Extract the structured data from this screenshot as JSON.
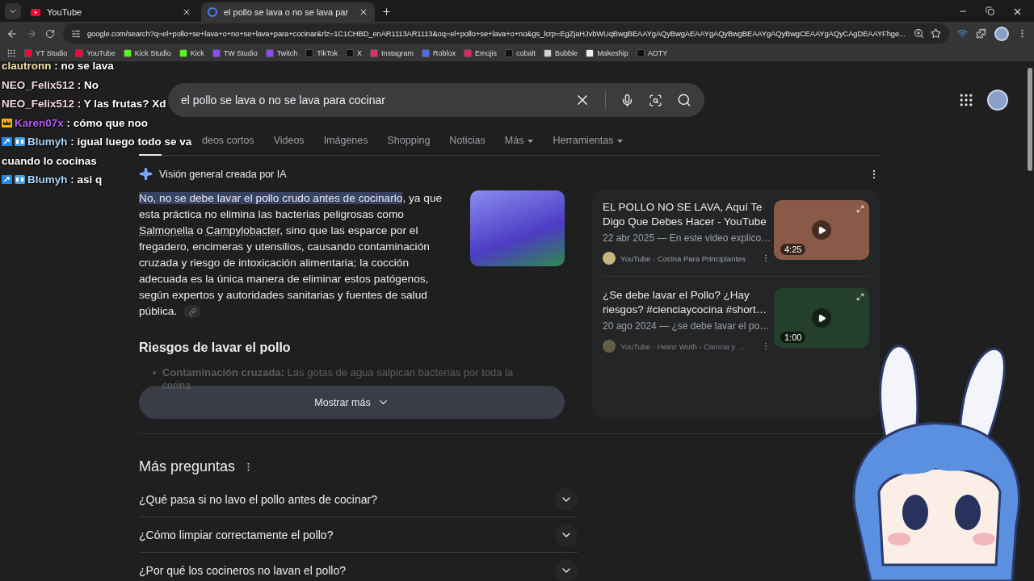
{
  "browser": {
    "tabs": [
      {
        "title": "YouTube",
        "selected": false
      },
      {
        "title": "el pollo se lava o no se lava par",
        "selected": true
      }
    ],
    "address": "google.com/search?q=el+pollo+se+lava+o+no+se+lava+para+cocinar&rlz=1C1CHBD_enAR1113AR1113&oq=el+pollo+se+lava+o+no&gs_lcrp=EgZjaHJvbWUqBwgBEAAYgAQyBwgAEAAYgAQyBwgBEAAYgAQyBwgCEAAYgAQyCAgDEAAYFhge...",
    "bookmarks": [
      {
        "label": "YT Studio",
        "color": "#ff0033"
      },
      {
        "label": "YouTube",
        "color": "#ff0033"
      },
      {
        "label": "Kick Studio",
        "color": "#53fc18"
      },
      {
        "label": "Kick",
        "color": "#53fc18"
      },
      {
        "label": "TW Studio",
        "color": "#9146ff"
      },
      {
        "label": "Twitch",
        "color": "#9146ff"
      },
      {
        "label": "TikTok",
        "color": "#111111"
      },
      {
        "label": "X",
        "color": "#111111"
      },
      {
        "label": "Instagram",
        "color": "#e1306c"
      },
      {
        "label": "Roblox",
        "color": "#4a6cf7"
      },
      {
        "label": "Emojis",
        "color": "#e0245e"
      },
      {
        "label": "cobalt",
        "color": "#111111"
      },
      {
        "label": "Bubble",
        "color": "#d0d0d0"
      },
      {
        "label": "Makeship",
        "color": "#f0f0f0"
      },
      {
        "label": "AOTY",
        "color": "#111111"
      }
    ]
  },
  "search": {
    "query": "el pollo se lava o no se lava para cocinar",
    "tabs": [
      {
        "label": "deos cortos"
      },
      {
        "label": "Videos"
      },
      {
        "label": "Imágenes"
      },
      {
        "label": "Shopping"
      },
      {
        "label": "Noticias"
      },
      {
        "label": "Más",
        "menu": true
      },
      {
        "label": "Herramientas",
        "menu": true
      }
    ]
  },
  "ai_overview": {
    "title": "Visión general creada por IA",
    "paragraph": [
      {
        "kind": "highlight",
        "text": "No, no se debe lavar el pollo crudo antes de cocinarlo"
      },
      {
        "kind": "plain",
        "text": ", ya que esta práctica no elimina las bacterias peligrosas como "
      },
      {
        "kind": "link",
        "text": "Salmonella"
      },
      {
        "kind": "plain",
        "text": " o "
      },
      {
        "kind": "link",
        "text": "Campylobacter"
      },
      {
        "kind": "plain",
        "text": ", sino que las esparce por el fregadero, encimeras y utensilios, causando contaminación cruzada y riesgo de intoxicación alimentaria; la cocción adecuada es la única manera de eliminar estos patógenos, según expertos y autoridades sanitarias y fuentes de salud pública."
      }
    ],
    "heading": "Riesgos de lavar el pollo",
    "bullet_term": "Contaminación cruzada:",
    "bullet_text": "Las gotas de agua salpican bacterias por toda la",
    "bullet_more": "cocina",
    "show_more": "Mostrar más"
  },
  "videos": [
    {
      "title": "EL POLLO NO SE LAVA, Aquí Te Digo Que Debes Hacer - YouTube",
      "meta": "22 abr 2025 — En este video explico…",
      "source": "YouTube",
      "channel": "· Cocina Para Principiantes",
      "duration": "4:25",
      "faded": false
    },
    {
      "title": "¿Se debe lavar el Pollo? ¿Hay riesgos? #cienciaycocina #short…",
      "meta": "20 ago 2024 — ¿se debe lavar el po…",
      "source": "YouTube",
      "channel": "· Heinz Wuth - Ciencia y …",
      "duration": "1:00",
      "faded": true
    }
  ],
  "more_questions": {
    "title": "Más preguntas",
    "items": [
      {
        "text": "¿Qué pasa si no lavo el pollo antes de cocinar?",
        "expanded": false
      },
      {
        "text": "¿Cómo limpiar correctamente el pollo?",
        "expanded": false
      },
      {
        "text": "¿Por qué los cocineros no lavan el pollo?",
        "expanded": false
      }
    ]
  },
  "chat": [
    {
      "kind": "plain",
      "name": "clautronn",
      "color": "#f3e3a6",
      "message": ": no se lava"
    },
    {
      "kind": "plain",
      "name": "NEO_Felix512",
      "color": "#f4d8e4",
      "message": ": No"
    },
    {
      "kind": "plain",
      "name": "NEO_Felix512",
      "color": "#f4d8e4",
      "message": ": Y las frutas? Xd"
    },
    {
      "kind": "crowned",
      "name": "Karen07x",
      "color": "#b45cf2",
      "message": ": cómo que noo"
    },
    {
      "kind": "booster",
      "name": "Blumyh",
      "color": "#a9d6ff",
      "message": ": igual luego todo se va cuando lo cocinas"
    },
    {
      "kind": "booster",
      "name": "Blumyh",
      "color": "#a9d6ff",
      "message": ": asi q"
    }
  ]
}
